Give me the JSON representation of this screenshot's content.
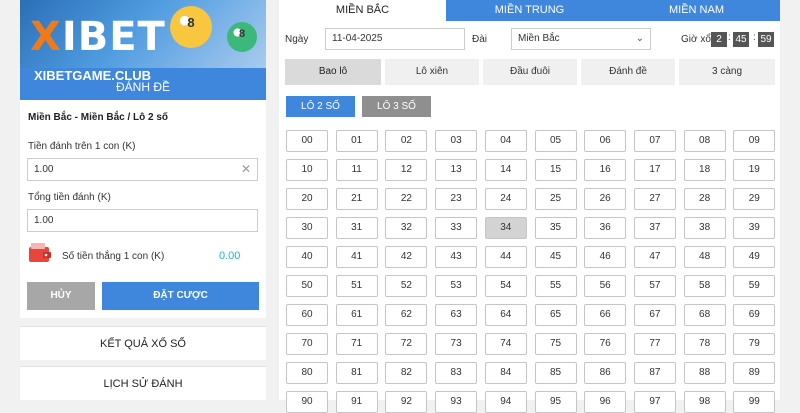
{
  "banner": {
    "logo_x": "X",
    "logo_rest": "IBET",
    "site": "XIBETGAME.CLUB",
    "subtitle": "ĐÁNH ĐỀ",
    "ball1": "8",
    "ball2": "8"
  },
  "form": {
    "breadcrumb": "Miền Bắc - Miền Bắc / Lô 2 số",
    "per_label": "Tiền đánh trên 1 con (K)",
    "per_value": "1.00",
    "clear_icon": "✕",
    "total_label": "Tổng tiền đánh (K)",
    "total_value": "1.00",
    "win_label": "Số tiền thắng 1 con (K)",
    "win_value": "0.00",
    "cancel_label": "HỦY",
    "place_label": "ĐẶT CƯỢC"
  },
  "panels": {
    "results": "KẾT QUẢ XỔ SỐ",
    "history": "LỊCH SỬ ĐÁNH"
  },
  "regions": [
    "MIỀN BẮC",
    "MIỀN TRUNG",
    "MIỀN NAM"
  ],
  "filters": {
    "date_label": "Ngày",
    "date_value": "11-04-2025",
    "station_label": "Đài",
    "station_value": "Miền Bắc",
    "time_label": "Giờ xổ",
    "time": [
      "2",
      "45",
      "59"
    ]
  },
  "bet_types": [
    "Bao lô",
    "Lô xiên",
    "Đầu đuôi",
    "Đánh đề",
    "3 càng"
  ],
  "sub_types": [
    "LÔ 2 SỐ",
    "LÔ 3 SỐ"
  ],
  "numbers": {
    "selected": "34",
    "rows": [
      [
        "00",
        "01",
        "02",
        "03",
        "04",
        "05",
        "06",
        "07",
        "08",
        "09"
      ],
      [
        "10",
        "11",
        "12",
        "13",
        "14",
        "15",
        "16",
        "17",
        "18",
        "19"
      ],
      [
        "20",
        "21",
        "22",
        "23",
        "24",
        "25",
        "26",
        "27",
        "28",
        "29"
      ],
      [
        "30",
        "31",
        "32",
        "33",
        "34",
        "35",
        "36",
        "37",
        "38",
        "39"
      ],
      [
        "40",
        "41",
        "42",
        "43",
        "44",
        "45",
        "46",
        "47",
        "48",
        "49"
      ],
      [
        "50",
        "51",
        "52",
        "53",
        "54",
        "55",
        "56",
        "57",
        "58",
        "59"
      ],
      [
        "60",
        "61",
        "62",
        "63",
        "64",
        "65",
        "66",
        "67",
        "68",
        "69"
      ],
      [
        "70",
        "71",
        "72",
        "73",
        "74",
        "75",
        "76",
        "77",
        "78",
        "79"
      ],
      [
        "80",
        "81",
        "82",
        "83",
        "84",
        "85",
        "86",
        "87",
        "88",
        "89"
      ],
      [
        "90",
        "91",
        "92",
        "93",
        "94",
        "95",
        "96",
        "97",
        "98",
        "99"
      ]
    ]
  },
  "colors": {
    "primary": "#3f87dc",
    "win": "#2cb0c9",
    "cancel": "#a7a7a7",
    "logo_accent": "#f07a1a",
    "subtab_inactive": "#8f8f8f"
  }
}
